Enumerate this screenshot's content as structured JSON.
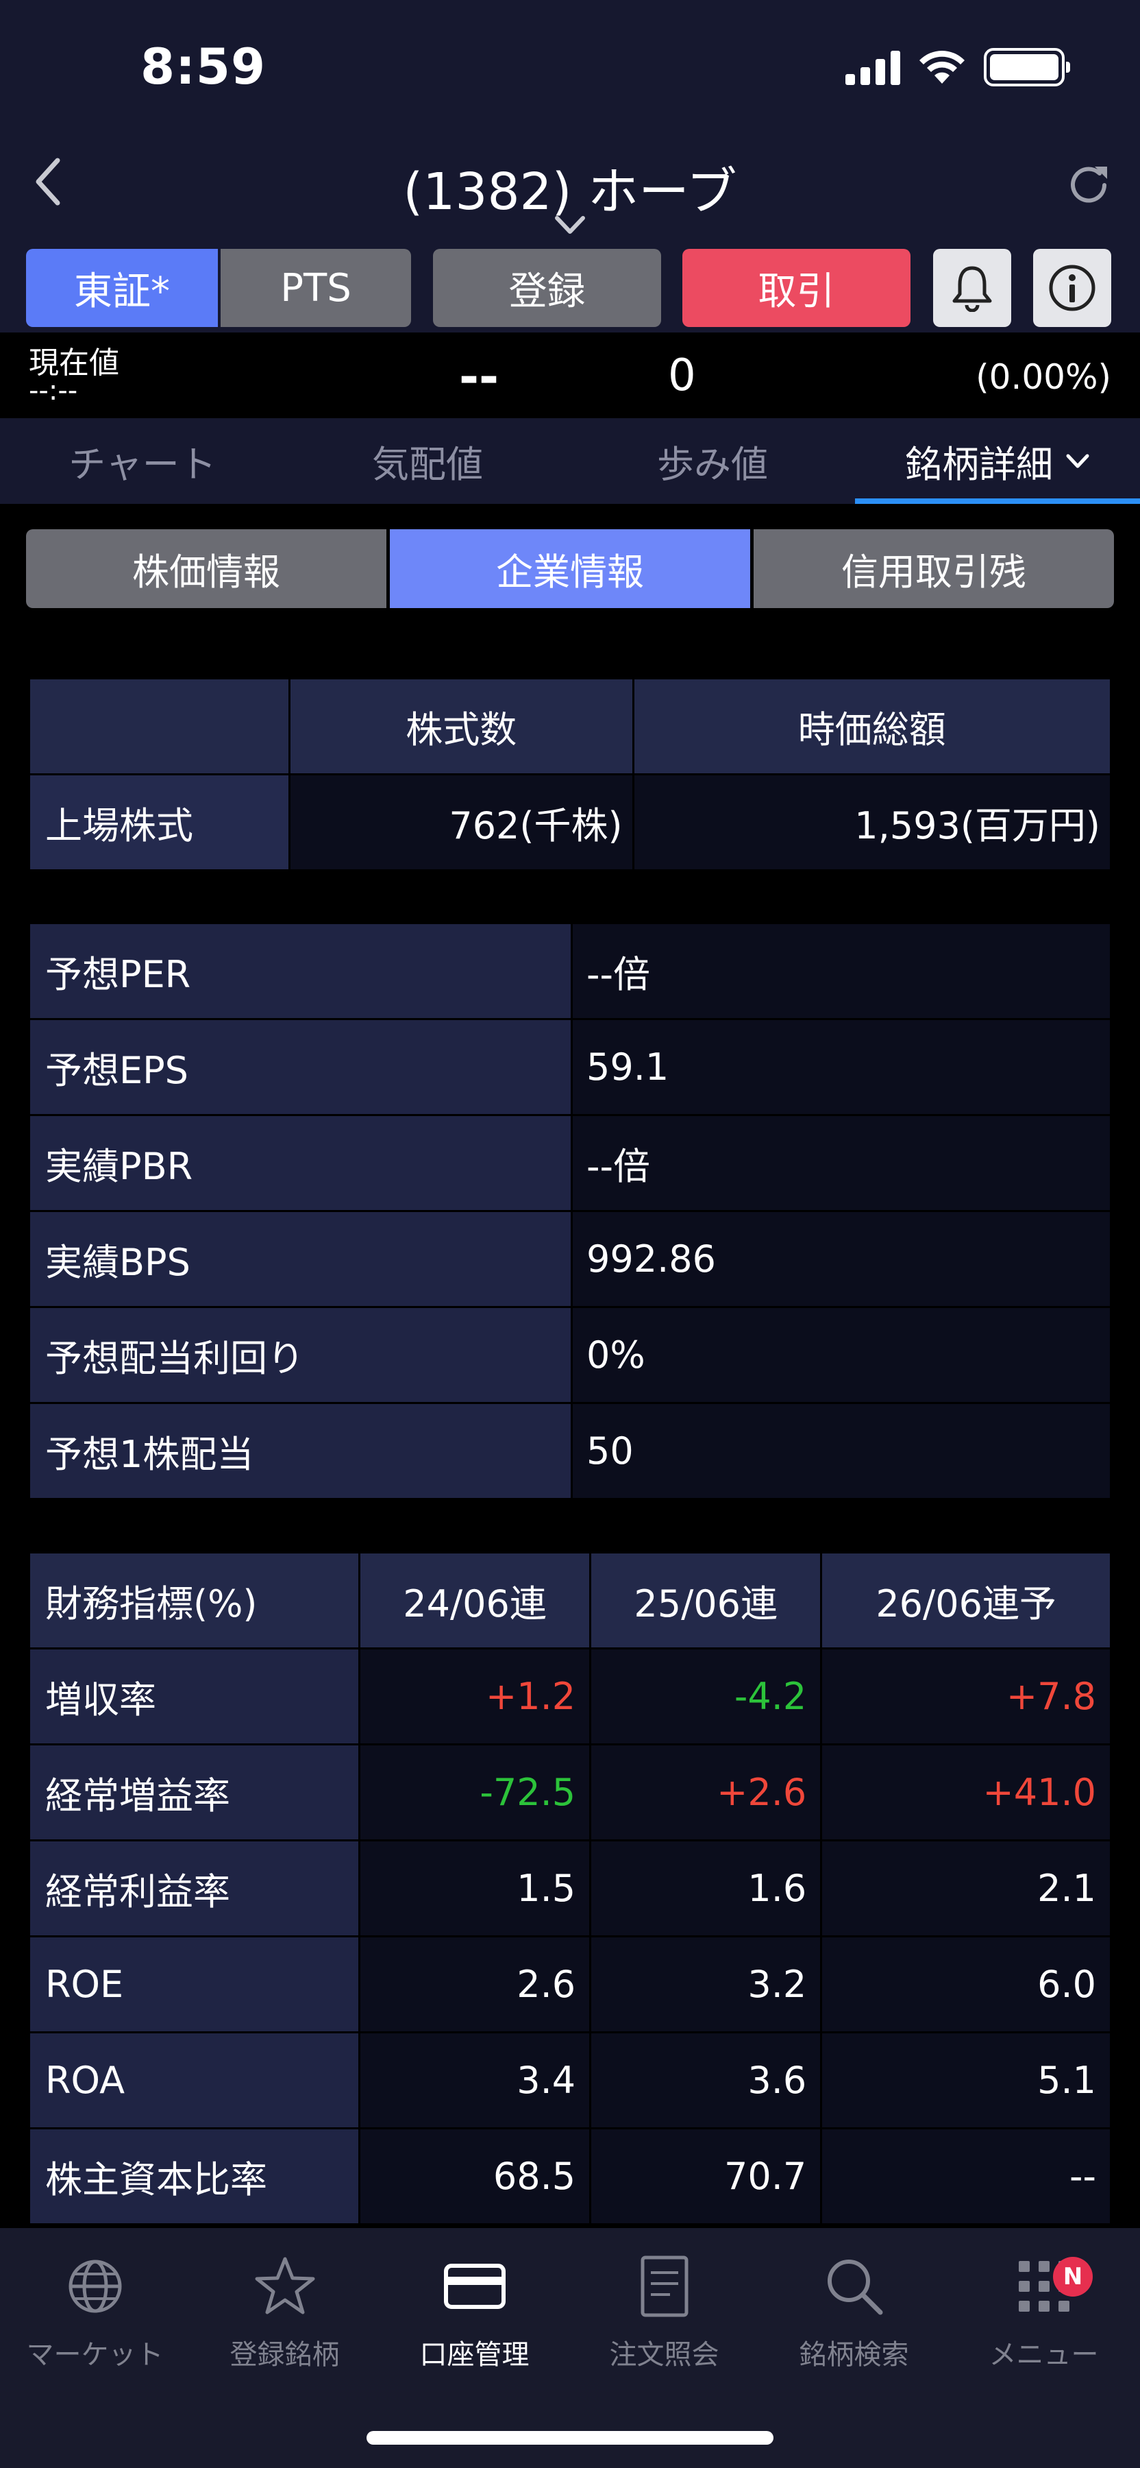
{
  "status_bar": {
    "time": "8:59"
  },
  "header": {
    "title": "(1382) ホーブ"
  },
  "segments": {
    "tse": "東証*",
    "pts": "PTS",
    "register": "登録",
    "trade": "取引"
  },
  "price": {
    "label": "現在値",
    "time": "--:--",
    "value": "--",
    "change": "0",
    "change_pct": "(0.00%)"
  },
  "tabs": [
    "チャート",
    "気配値",
    "歩み値",
    "銘柄詳細"
  ],
  "subtabs": [
    "株価情報",
    "企業情報",
    "信用取引残"
  ],
  "shares_table": {
    "headers": [
      "",
      "株式数",
      "時価総額"
    ],
    "row_label": "上場株式",
    "shares": "762(千株)",
    "market_cap": "1,593(百万円)"
  },
  "valuation": [
    {
      "label": "予想PER",
      "value": "--倍"
    },
    {
      "label": "予想EPS",
      "value": "59.1"
    },
    {
      "label": "実績PBR",
      "value": "--倍"
    },
    {
      "label": "実績BPS",
      "value": "992.86"
    },
    {
      "label": "予想配当利回り",
      "value": "0%"
    },
    {
      "label": "予想1株配当",
      "value": "50"
    }
  ],
  "financials": {
    "headers": [
      "財務指標(%)",
      "24/06連",
      "25/06連",
      "26/06連予"
    ],
    "rows": [
      {
        "label": "増収率",
        "values": [
          "+1.2",
          "-4.2",
          "+7.8"
        ]
      },
      {
        "label": "経常増益率",
        "values": [
          "-72.5",
          "+2.6",
          "+41.0"
        ]
      },
      {
        "label": "経常利益率",
        "values": [
          "1.5",
          "1.6",
          "2.1"
        ]
      },
      {
        "label": "ROE",
        "values": [
          "2.6",
          "3.2",
          "6.0"
        ]
      },
      {
        "label": "ROA",
        "values": [
          "3.4",
          "3.6",
          "5.1"
        ]
      },
      {
        "label": "株主資本比率",
        "values": [
          "68.5",
          "70.7",
          "--"
        ]
      }
    ]
  },
  "bottom_nav": {
    "items": [
      {
        "label": "マーケット",
        "icon": "globe-icon"
      },
      {
        "label": "登録銘柄",
        "icon": "star-icon"
      },
      {
        "label": "口座管理",
        "icon": "card-icon"
      },
      {
        "label": "注文照会",
        "icon": "document-icon"
      },
      {
        "label": "銘柄検索",
        "icon": "search-icon"
      },
      {
        "label": "メニュー",
        "icon": "grid-icon"
      }
    ],
    "badge": "N"
  },
  "colors": {
    "accent_blue": "#5b7bf7",
    "trade_red": "#ec4b61",
    "positive": "#f0473a",
    "negative": "#2cc33a"
  }
}
